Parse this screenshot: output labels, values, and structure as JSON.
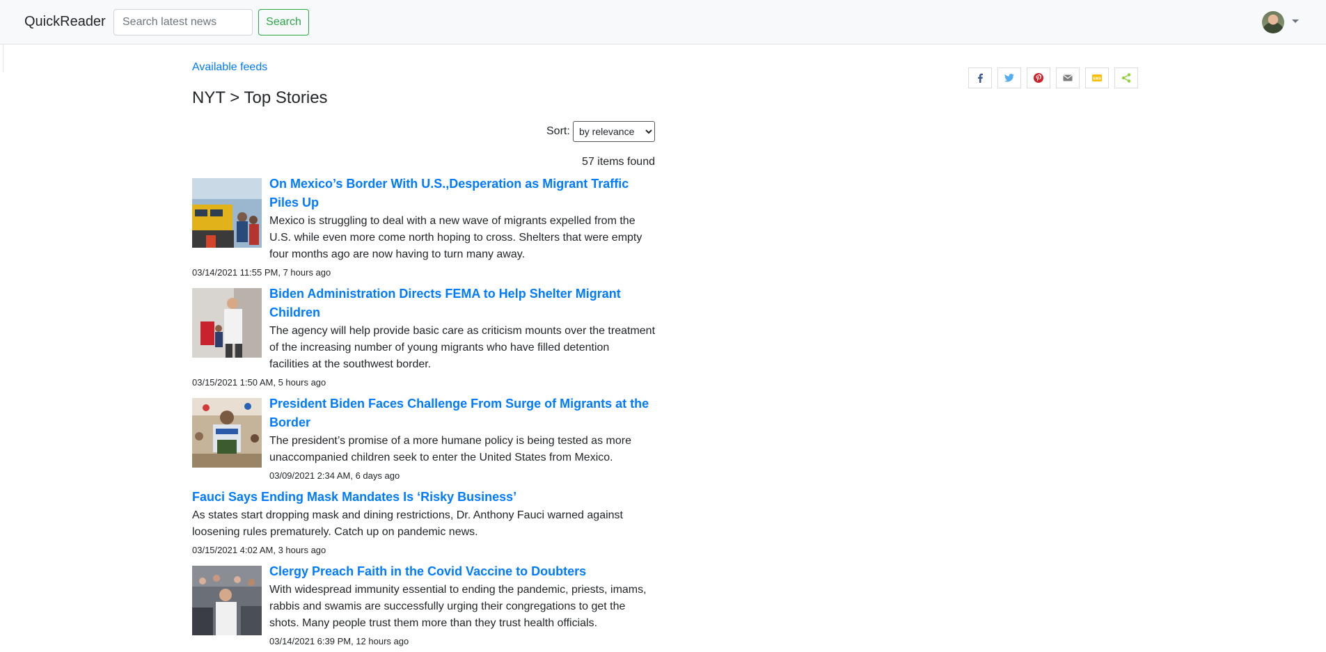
{
  "header": {
    "brand": "QuickReader",
    "search_placeholder": "Search latest news",
    "search_label": "Search"
  },
  "main": {
    "feeds_link": "Available feeds",
    "title": "NYT > Top Stories",
    "sort_label": "Sort:",
    "sort_value": "by relevance",
    "items_found": "57 items found"
  },
  "share_icons": [
    "facebook-icon",
    "twitter-icon",
    "pinterest-icon",
    "email-icon",
    "sms-icon",
    "share-icon"
  ],
  "colors": {
    "link": "#007bff",
    "success": "#28a745",
    "facebook": "#3b5998",
    "twitter": "#55acee",
    "pinterest": "#cb2027",
    "email": "#7d7d7d",
    "sms": "#ffbd00",
    "share": "#95d03a"
  },
  "articles": [
    {
      "title_line1": "On Mexico’s Border With U.S.,Desperation as Migrant Traffic",
      "title_line2": "Piles Up",
      "desc_line1": "Mexico is struggling to deal with a new wave of migrants expelled from the",
      "desc_line2": "U.S. while even more come north hoping to cross. Shelters that were empty",
      "desc_line3": "four months ago are now having to turn many away.",
      "date": "03/14/2021 11:55 PM, 7 hours ago"
    },
    {
      "title_line1": "Biden Administration Directs FEMA to Help Shelter Migrant",
      "title_line2": "Children",
      "desc_line1": "The agency will help provide basic care as criticism mounts over the treatment",
      "desc_line2": "of the increasing number of young migrants who have filled detention",
      "desc_line3": "facilities at the southwest border.",
      "date": "03/15/2021 1:50 AM, 5 hours ago"
    },
    {
      "title_line1": "President Biden Faces Challenge From Surge of Migrants at the",
      "title_line2": "Border",
      "desc_line1": "The president’s promise of a more humane policy is being tested as more",
      "desc_line2": "unaccompanied children seek to enter the United States from Mexico.",
      "date": "03/09/2021 2:34 AM, 6 days ago"
    },
    {
      "title_line1": "Fauci Says Ending Mask Mandates Is ‘Risky Business’",
      "desc_line1": "As states start dropping mask and dining restrictions, Dr. Anthony Fauci warned against",
      "desc_line2": "loosening rules prematurely. Catch up on pandemic news.",
      "date": "03/15/2021 4:02 AM, 3 hours ago"
    },
    {
      "title_line1": "Clergy Preach Faith in the Covid Vaccine to Doubters",
      "desc_line1": "With widespread immunity essential to ending the pandemic, priests, imams,",
      "desc_line2": "rabbis and swamis are successfully urging their congregations to get the",
      "desc_line3": "shots. Many people trust them more than they trust health officials.",
      "date": "03/14/2021 6:39 PM, 12 hours ago"
    }
  ]
}
